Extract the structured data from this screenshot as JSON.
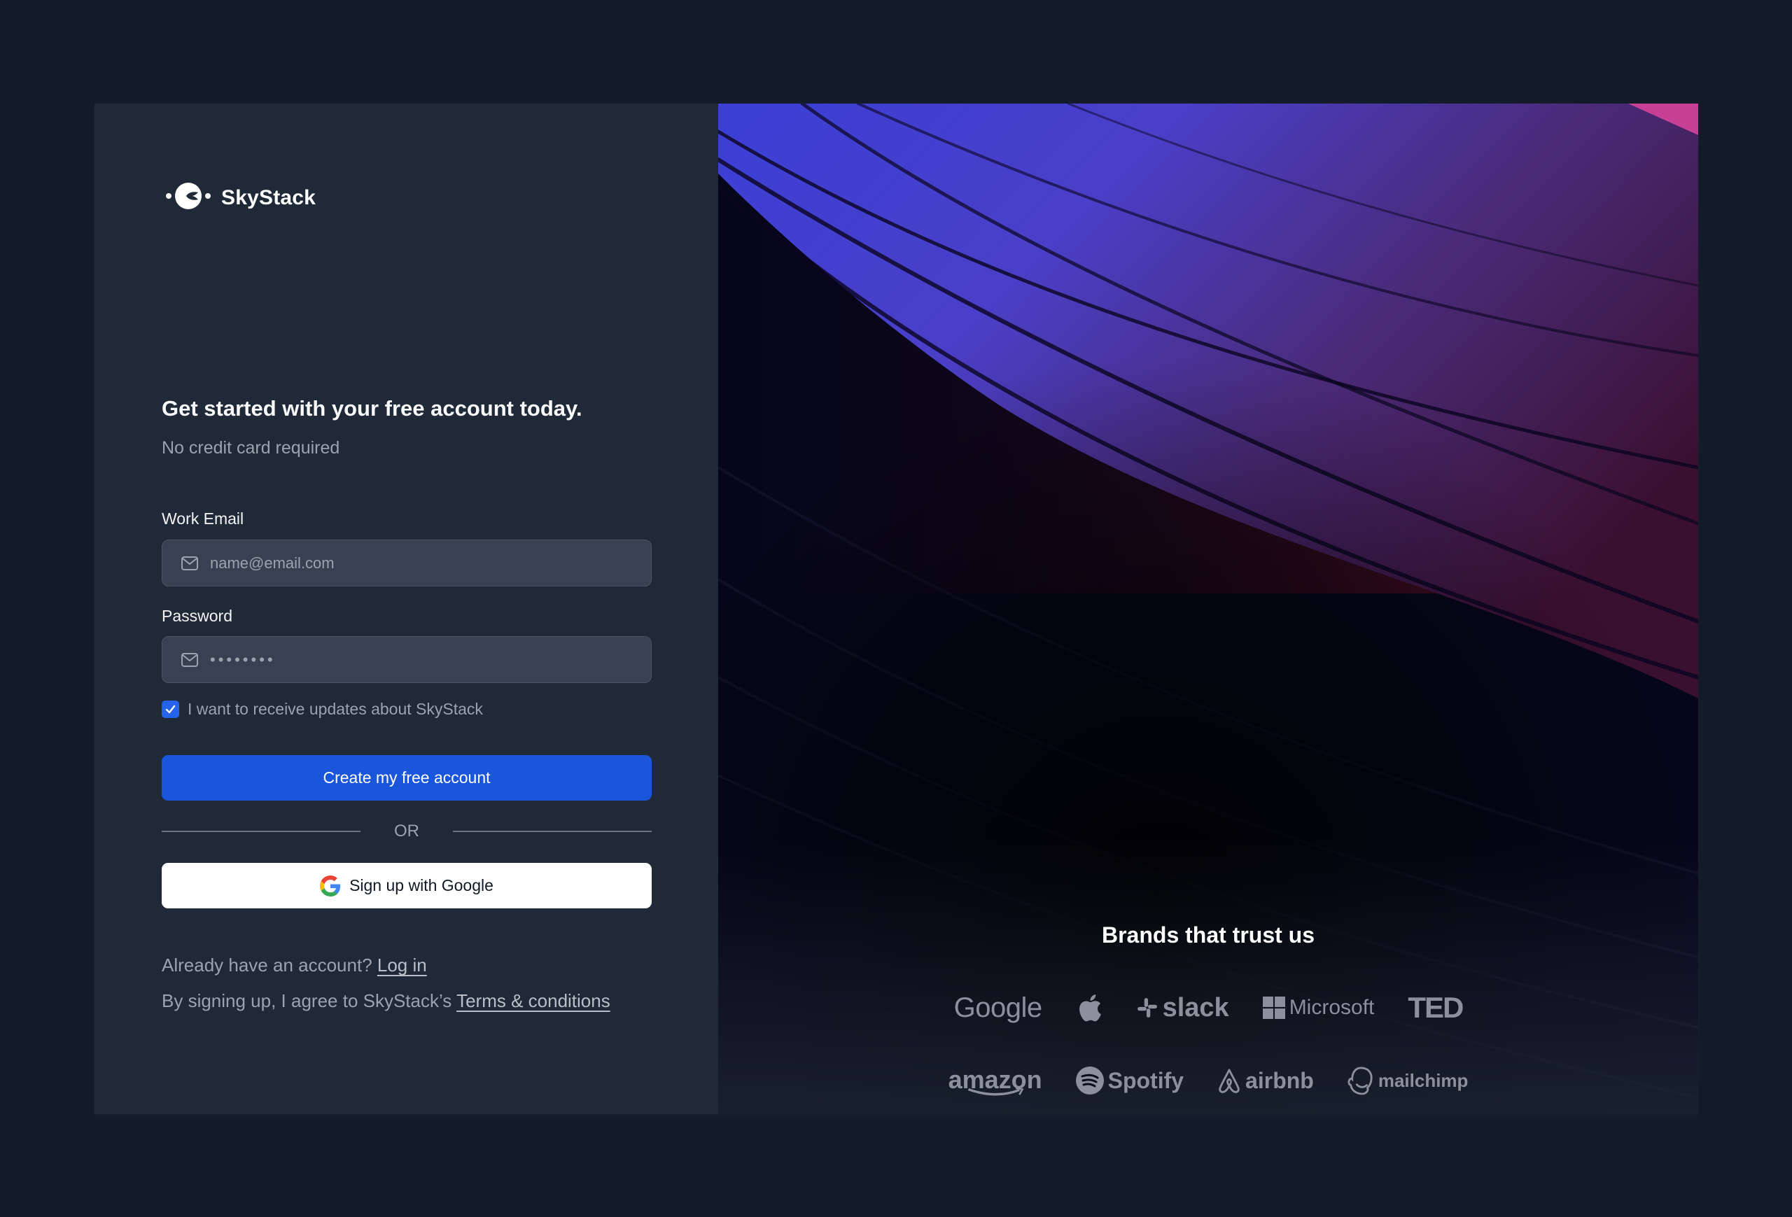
{
  "brand": {
    "name": "SkyStack",
    "logo_icon": "skystack-orbit-icon"
  },
  "form": {
    "heading": "Get started with your free account today.",
    "subheading": "No credit card required",
    "email": {
      "label": "Work Email",
      "placeholder": "name@email.com",
      "value": "",
      "icon": "mail-icon"
    },
    "password": {
      "label": "Password",
      "value": "••••••••",
      "icon": "mail-icon"
    },
    "updates_checkbox": {
      "label": "I want to receive updates about SkyStack",
      "checked": true
    },
    "submit_label": "Create my free account",
    "divider_label": "OR",
    "google_label": "Sign up with Google",
    "login_prompt": "Already have an account?",
    "login_link": "Log in",
    "terms_prompt": "By signing up, I agree to SkyStack’s",
    "terms_link": "Terms & conditions"
  },
  "brands": {
    "title": "Brands that trust us",
    "row1": [
      "Google",
      "Apple",
      "slack",
      "Microsoft",
      "TED"
    ],
    "row2": [
      "amazon",
      "Spotify",
      "airbnb",
      "mailchimp"
    ]
  },
  "colors": {
    "page_bg": "#131a2a",
    "panel_bg": "#1f2937",
    "input_bg": "#374151",
    "primary": "#1a56db",
    "checkbox": "#2563eb",
    "muted_text": "#9ca3af",
    "logo_gray": "#8b909c"
  }
}
